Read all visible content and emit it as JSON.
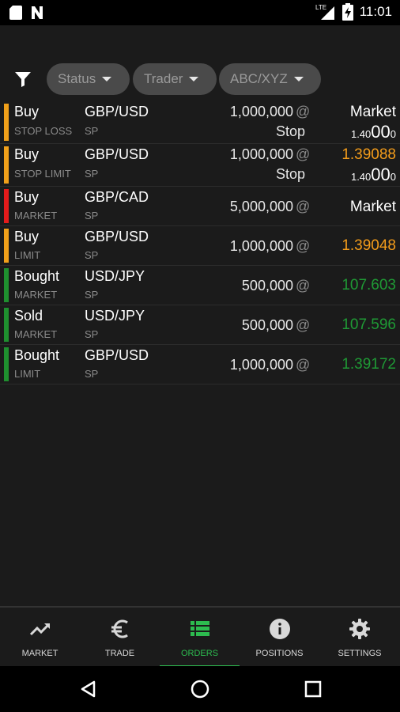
{
  "status_bar": {
    "time": "11:01",
    "network": "LTE"
  },
  "filters": [
    {
      "label": "Status"
    },
    {
      "label": "Trader"
    },
    {
      "label": "ABC/XYZ"
    }
  ],
  "orders": [
    {
      "side": "Buy",
      "type": "STOP LOSS",
      "pair": "GBP/USD",
      "tenor": "SP",
      "qty": "1,000,000",
      "at": "@",
      "price": "Market",
      "stop_label": "Stop",
      "colon": ":",
      "stop_small": "1.40",
      "stop_big": "00",
      "stop_tail": "0",
      "bar_color": "#f0a01a",
      "price_color": "#ffffff"
    },
    {
      "side": "Buy",
      "type": "STOP LIMIT",
      "pair": "GBP/USD",
      "tenor": "SP",
      "qty": "1,000,000",
      "at": "@",
      "price": "1.39088",
      "stop_label": "Stop",
      "colon": ":",
      "stop_small": "1.40",
      "stop_big": "00",
      "stop_tail": "0",
      "bar_color": "#f0a01a",
      "price_color": "#f39c1b"
    },
    {
      "side": "Buy",
      "type": "MARKET",
      "pair": "GBP/CAD",
      "tenor": "SP",
      "qty": "5,000,000",
      "at": "@",
      "price": "Market",
      "bar_color": "#e41b1b",
      "price_color": "#ffffff"
    },
    {
      "side": "Buy",
      "type": "LIMIT",
      "pair": "GBP/USD",
      "tenor": "SP",
      "qty": "1,000,000",
      "at": "@",
      "price": "1.39048",
      "bar_color": "#f0a01a",
      "price_color": "#f39c1b"
    },
    {
      "side": "Bought",
      "type": "MARKET",
      "pair": "USD/JPY",
      "tenor": "SP",
      "qty": "500,000",
      "at": "@",
      "price": "107.603",
      "bar_color": "#1f8f2f",
      "price_color": "#1f9a35"
    },
    {
      "side": "Sold",
      "type": "MARKET",
      "pair": "USD/JPY",
      "tenor": "SP",
      "qty": "500,000",
      "at": "@",
      "price": "107.596",
      "bar_color": "#1f8f2f",
      "price_color": "#1f9a35"
    },
    {
      "side": "Bought",
      "type": "LIMIT",
      "pair": "GBP/USD",
      "tenor": "SP",
      "qty": "1,000,000",
      "at": "@",
      "price": "1.39172",
      "bar_color": "#1f8f2f",
      "price_color": "#1f9a35"
    }
  ],
  "nav": [
    {
      "label": "MARKET",
      "icon": "trending-up-icon"
    },
    {
      "label": "TRADE",
      "icon": "euro-icon"
    },
    {
      "label": "ORDERS",
      "icon": "list-icon",
      "active": true
    },
    {
      "label": "POSITIONS",
      "icon": "info-icon"
    },
    {
      "label": "SETTINGS",
      "icon": "gear-icon"
    }
  ],
  "colors": {
    "accent": "#2dbb4f",
    "background": "#1b1b1b",
    "chip": "#4a4a4a"
  }
}
